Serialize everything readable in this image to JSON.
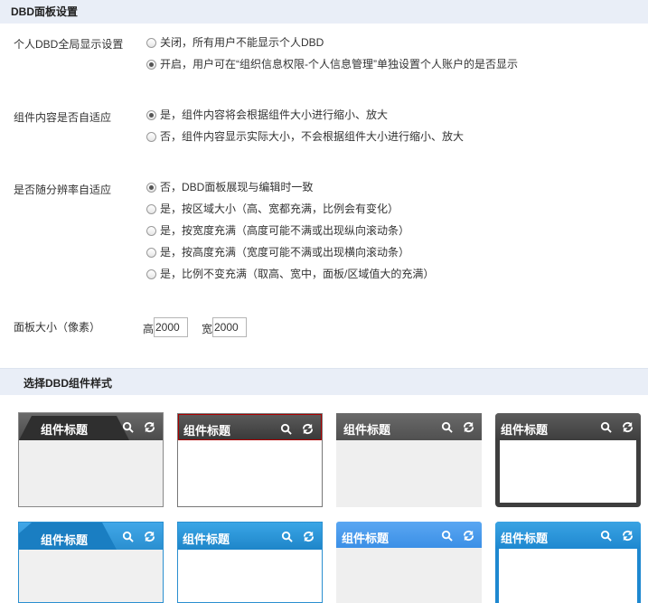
{
  "sections": {
    "dbd_settings_title": "DBD面板设置",
    "widget_style_title": "选择DBD组件样式"
  },
  "personal_dbd": {
    "label": "个人DBD全局显示设置",
    "options": [
      {
        "text": "关闭，所有用户不能显示个人DBD",
        "checked": false
      },
      {
        "text": "开启，用户可在“组织信息权限-个人信息管理”单独设置个人账户的是否显示",
        "checked": true
      }
    ]
  },
  "content_adapt": {
    "label": "组件内容是否自适应",
    "options": [
      {
        "text": "是，组件内容将会根据组件大小进行缩小、放大",
        "checked": true
      },
      {
        "text": "否，组件内容显示实际大小，不会根据组件大小进行缩小、放大",
        "checked": false
      }
    ]
  },
  "resolution_adapt": {
    "label": "是否随分辨率自适应",
    "options": [
      {
        "text": "否，DBD面板展现与编辑时一致",
        "checked": true
      },
      {
        "text": "是，按区域大小（高、宽都充满，比例会有变化）",
        "checked": false
      },
      {
        "text": "是，按宽度充满（高度可能不满或出现纵向滚动条）",
        "checked": false
      },
      {
        "text": "是，按高度充满（宽度可能不满或出现横向滚动条）",
        "checked": false
      },
      {
        "text": "是，比例不变充满（取高、宽中，面板/区域值大的充满）",
        "checked": false
      }
    ]
  },
  "panel_size": {
    "label": "面板大小（像素）",
    "height_label": "高",
    "height_value": "2000",
    "width_label": "宽",
    "width_value": "2000"
  },
  "widget_styles": [
    {
      "title": "组件标题",
      "icons": [
        "search-icon",
        "refresh-icon"
      ],
      "theme": "dark-tab"
    },
    {
      "title": "组件标题",
      "icons": [
        "search-icon",
        "refresh-icon"
      ],
      "theme": "dark-red-border"
    },
    {
      "title": "组件标题",
      "icons": [
        "search-icon",
        "refresh-icon"
      ],
      "theme": "dark-flat"
    },
    {
      "title": "组件标题",
      "icons": [
        "search-icon",
        "refresh-icon"
      ],
      "theme": "dark-frame"
    },
    {
      "title": "组件标题",
      "icons": [
        "search-icon",
        "refresh-icon"
      ],
      "theme": "blue-tab"
    },
    {
      "title": "组件标题",
      "icons": [
        "search-icon",
        "refresh-icon"
      ],
      "theme": "blue-gradient"
    },
    {
      "title": "组件标题",
      "icons": [
        "search-icon",
        "refresh-icon"
      ],
      "theme": "light-blue"
    },
    {
      "title": "组件标题",
      "icons": [
        "search-icon",
        "refresh-icon"
      ],
      "theme": "blue-frame"
    }
  ]
}
